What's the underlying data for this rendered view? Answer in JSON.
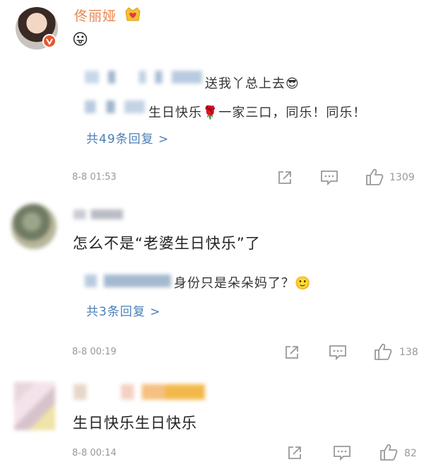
{
  "comments": [
    {
      "user_name": "佟丽娅",
      "body_emoji": "😛",
      "replies": [
        {
          "user_blurred": "▒▒▒",
          "text": "送我丫总上去😎"
        },
        {
          "user_blurred": "▒▒▒",
          "text": "生日快乐🌹一家三口，同乐！同乐！"
        }
      ],
      "more_replies": "共49条回复 >",
      "time": "8-8 01:53",
      "likes": "1309"
    },
    {
      "user_name_blurred": "▒▒▒",
      "body": "怎么不是“老婆生日快乐”了",
      "replies": [
        {
          "user_blurred": "▒▒▒",
          "text": "身份只是朵朵妈了？🙂"
        }
      ],
      "more_replies": "共3条回复 >",
      "time": "8-8 00:19",
      "likes": "138"
    },
    {
      "user_name_blurred": "▒▒▒",
      "body": "生日快乐生日快乐",
      "time": "8-8 00:14",
      "likes": "82"
    }
  ],
  "colors": {
    "username": "#e8834a",
    "link": "#4a7fb5",
    "verified": "#e4572e",
    "muted": "#999999"
  },
  "icons": [
    "share-icon",
    "comment-icon",
    "thumbs-up-icon",
    "verified-badge-icon",
    "crown-heart-badge-icon"
  ]
}
